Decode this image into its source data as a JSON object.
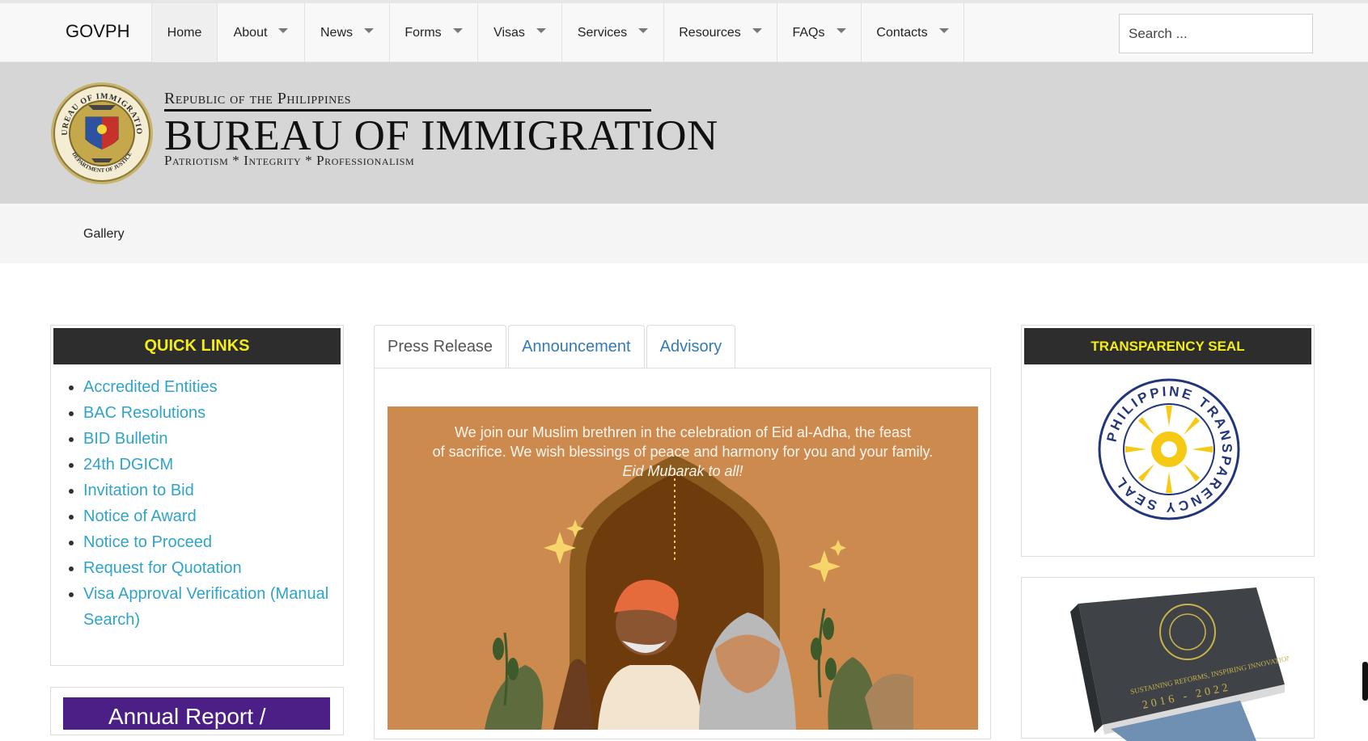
{
  "nav": {
    "brand": "GOVPH",
    "items": [
      {
        "label": "Home",
        "dropdown": false,
        "active": true
      },
      {
        "label": "About",
        "dropdown": true
      },
      {
        "label": "News",
        "dropdown": true
      },
      {
        "label": "Forms",
        "dropdown": true
      },
      {
        "label": "Visas",
        "dropdown": true
      },
      {
        "label": "Services",
        "dropdown": true
      },
      {
        "label": "Resources",
        "dropdown": true
      },
      {
        "label": "FAQs",
        "dropdown": true
      },
      {
        "label": "Contacts",
        "dropdown": true
      }
    ],
    "search_placeholder": "Search ..."
  },
  "header": {
    "republic": "Republic of the Philippines",
    "bureau": "BUREAU OF IMMIGRATION",
    "motto": "Patriotism * Integrity * Professionalism",
    "seal_ring_top": "BUREAU OF IMMIGRATION",
    "seal_ring_bottom": "DEPARTMENT OF JUSTICE"
  },
  "subnav": {
    "gallery": "Gallery"
  },
  "quick_links": {
    "title": "QUICK LINKS",
    "items": [
      "Accredited Entities",
      "BAC Resolutions",
      "BID Bulletin",
      "24th DGICM",
      "Invitation to Bid",
      "Notice of Award",
      "Notice to Proceed",
      "Request for Quotation",
      "Visa Approval Verification (Manual Search)"
    ]
  },
  "annual_report": "Annual Report /",
  "tabs": [
    {
      "label": "Press Release",
      "active": true
    },
    {
      "label": "Announcement"
    },
    {
      "label": "Advisory"
    }
  ],
  "eid": {
    "line1": "We join our Muslim brethren in the celebration of Eid al-Adha, the feast",
    "line2": "of sacrifice. We wish blessings of peace and harmony for you and your family.",
    "line3": "Eid Mubarak to all!"
  },
  "transparency": {
    "title": "TRANSPARENCY SEAL",
    "seal_text": "PHILIPPINE TRANSPARENCY SEAL"
  },
  "book": {
    "text": "SUSTAINING REFORMS, INSPIRING INNOVATION",
    "years": "2016 - 2022"
  },
  "colors": {
    "link": "#2fa3cc",
    "panel_header_bg": "#2d2d2d",
    "panel_header_text": "#f3ec19",
    "eid_bg": "#cd8a4f",
    "header_bg": "#d6d6d6"
  }
}
